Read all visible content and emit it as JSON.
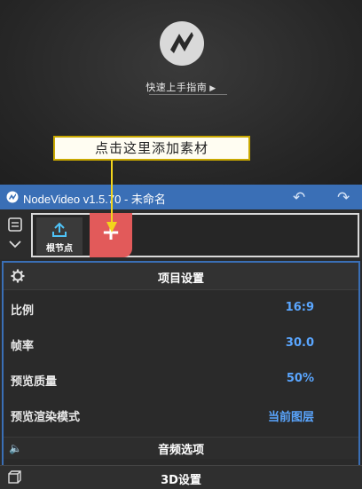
{
  "preview": {
    "guide_link": "快速上手指南",
    "guide_arrow": "▶"
  },
  "tip": {
    "text": "点击这里添加素材"
  },
  "titlebar": {
    "title": "NodeVideo v1.5.70 - 未命名",
    "undo": "↶",
    "redo": "↷"
  },
  "track": {
    "root_node_label": "根节点",
    "add_symbol": "+"
  },
  "project_settings": {
    "header": "项目设置",
    "rows": [
      {
        "label": "比例",
        "value": "16:9"
      },
      {
        "label": "帧率",
        "value": "30.0"
      },
      {
        "label": "预览质量",
        "value": "50%"
      },
      {
        "label": "预览渲染模式",
        "value": "当前图层"
      }
    ]
  },
  "audio": {
    "header": "音频选项",
    "icon": "🔈"
  },
  "footer": {
    "label": "3D设置"
  },
  "colors": {
    "accent_blue": "#3a6fb6",
    "value_blue": "#5aa6ff",
    "add_button_red": "#e25a5a",
    "tip_border": "#c9a800",
    "pointer_yellow": "#f2d41c"
  }
}
